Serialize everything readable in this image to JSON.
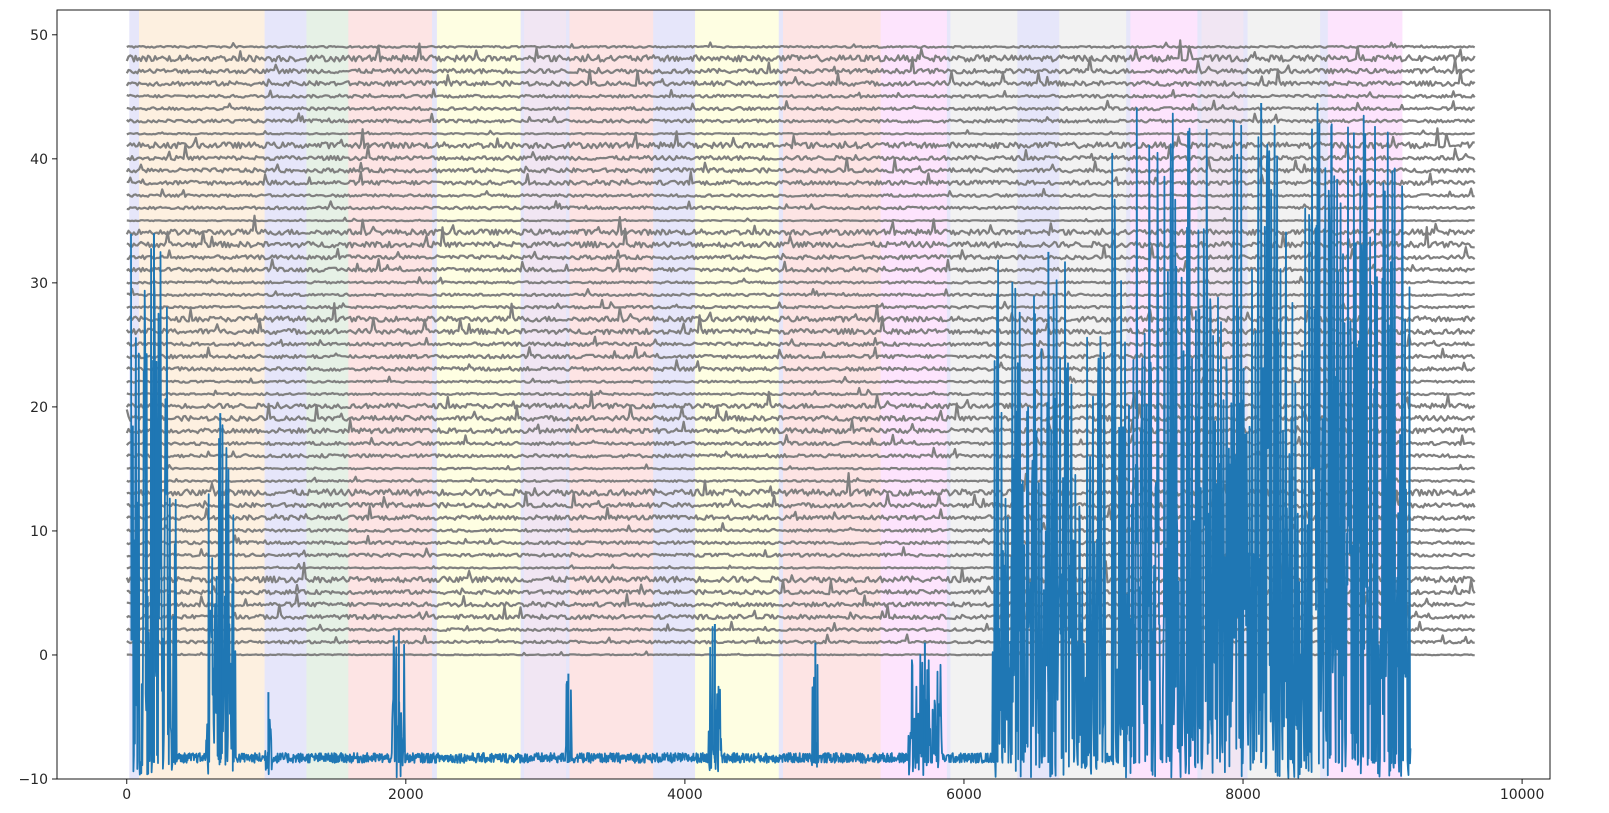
{
  "chart_data": {
    "type": "line",
    "title": "",
    "xlabel": "",
    "ylabel": "",
    "xlim": [
      -500,
      10200
    ],
    "ylim": [
      -10,
      52
    ],
    "x_ticks": [
      0,
      2000,
      4000,
      6000,
      8000,
      10000
    ],
    "y_ticks": [
      -10,
      0,
      10,
      20,
      30,
      40,
      50
    ],
    "x_tick_labels": [
      "0",
      "2000",
      "4000",
      "6000",
      "8000",
      "10000"
    ],
    "y_tick_labels": [
      "−10",
      "0",
      "10",
      "20",
      "30",
      "40",
      "50"
    ],
    "grid": false,
    "legend": "none",
    "channel_traces": {
      "color": "#808080",
      "count": 50,
      "offsets": [
        0,
        1,
        2,
        3,
        4,
        5,
        6,
        7,
        8,
        9,
        10,
        11,
        12,
        13,
        14,
        15,
        16,
        17,
        18,
        19,
        20,
        21,
        22,
        23,
        24,
        25,
        26,
        27,
        28,
        29,
        30,
        31,
        32,
        33,
        34,
        35,
        36,
        37,
        38,
        39,
        40,
        41,
        42,
        43,
        44,
        45,
        46,
        47,
        48,
        49
      ],
      "x_range": [
        0,
        9660
      ]
    },
    "main_series": {
      "color": "#1f77b4",
      "x_range": [
        30,
        9200
      ],
      "baseline": -8.7,
      "bursts": [
        {
          "x_start": 30,
          "x_end": 360,
          "peak": 34
        },
        {
          "x_start": 560,
          "x_end": 780,
          "peak": 19.5
        },
        {
          "x_start": 990,
          "x_end": 1040,
          "peak": -3
        },
        {
          "x_start": 1900,
          "x_end": 2000,
          "peak": 2
        },
        {
          "x_start": 3140,
          "x_end": 3190,
          "peak": -1.5
        },
        {
          "x_start": 4170,
          "x_end": 4260,
          "peak": 2.5
        },
        {
          "x_start": 4910,
          "x_end": 4960,
          "peak": 1
        },
        {
          "x_start": 5600,
          "x_end": 5840,
          "peak": 1
        },
        {
          "x_start": 6200,
          "x_end": 7010,
          "peak": 32.5
        },
        {
          "x_start": 7060,
          "x_end": 9200,
          "peak": 44.5
        }
      ]
    },
    "background_bands": [
      {
        "x_start": 20,
        "x_end": 90,
        "color": "#e6e6fa"
      },
      {
        "x_start": 90,
        "x_end": 990,
        "color": "#fdf0e0"
      },
      {
        "x_start": 990,
        "x_end": 1290,
        "color": "#e6e6fa"
      },
      {
        "x_start": 1290,
        "x_end": 1590,
        "color": "#e6f1e6"
      },
      {
        "x_start": 1590,
        "x_end": 2190,
        "color": "#fde4e4"
      },
      {
        "x_start": 2190,
        "x_end": 2225,
        "color": "#e6e6fa"
      },
      {
        "x_start": 2225,
        "x_end": 2825,
        "color": "#fefee2"
      },
      {
        "x_start": 2825,
        "x_end": 2850,
        "color": "#e6e6fa"
      },
      {
        "x_start": 2850,
        "x_end": 3150,
        "color": "#f1e6f3"
      },
      {
        "x_start": 3150,
        "x_end": 3175,
        "color": "#e6e6fa"
      },
      {
        "x_start": 3175,
        "x_end": 3775,
        "color": "#fde4e4"
      },
      {
        "x_start": 3775,
        "x_end": 4075,
        "color": "#e6e6fa"
      },
      {
        "x_start": 4075,
        "x_end": 4675,
        "color": "#fefee2"
      },
      {
        "x_start": 4675,
        "x_end": 4705,
        "color": "#e6e6fa"
      },
      {
        "x_start": 4705,
        "x_end": 5405,
        "color": "#fde4e4"
      },
      {
        "x_start": 5405,
        "x_end": 5880,
        "color": "#fde4fd"
      },
      {
        "x_start": 5880,
        "x_end": 5905,
        "color": "#e6e6fa"
      },
      {
        "x_start": 5905,
        "x_end": 6385,
        "color": "#f2f2f2"
      },
      {
        "x_start": 6385,
        "x_end": 6685,
        "color": "#e6e6fa"
      },
      {
        "x_start": 6685,
        "x_end": 7165,
        "color": "#f2f2f2"
      },
      {
        "x_start": 7165,
        "x_end": 7195,
        "color": "#e6e6fa"
      },
      {
        "x_start": 7195,
        "x_end": 7675,
        "color": "#fde4fd"
      },
      {
        "x_start": 7675,
        "x_end": 7705,
        "color": "#e6e6fa"
      },
      {
        "x_start": 7705,
        "x_end": 8005,
        "color": "#f1e6f3"
      },
      {
        "x_start": 8005,
        "x_end": 8035,
        "color": "#e6e6fa"
      },
      {
        "x_start": 8035,
        "x_end": 8555,
        "color": "#f2f2f2"
      },
      {
        "x_start": 8555,
        "x_end": 8610,
        "color": "#e6e6fa"
      },
      {
        "x_start": 8610,
        "x_end": 9140,
        "color": "#fde4fd"
      }
    ]
  }
}
